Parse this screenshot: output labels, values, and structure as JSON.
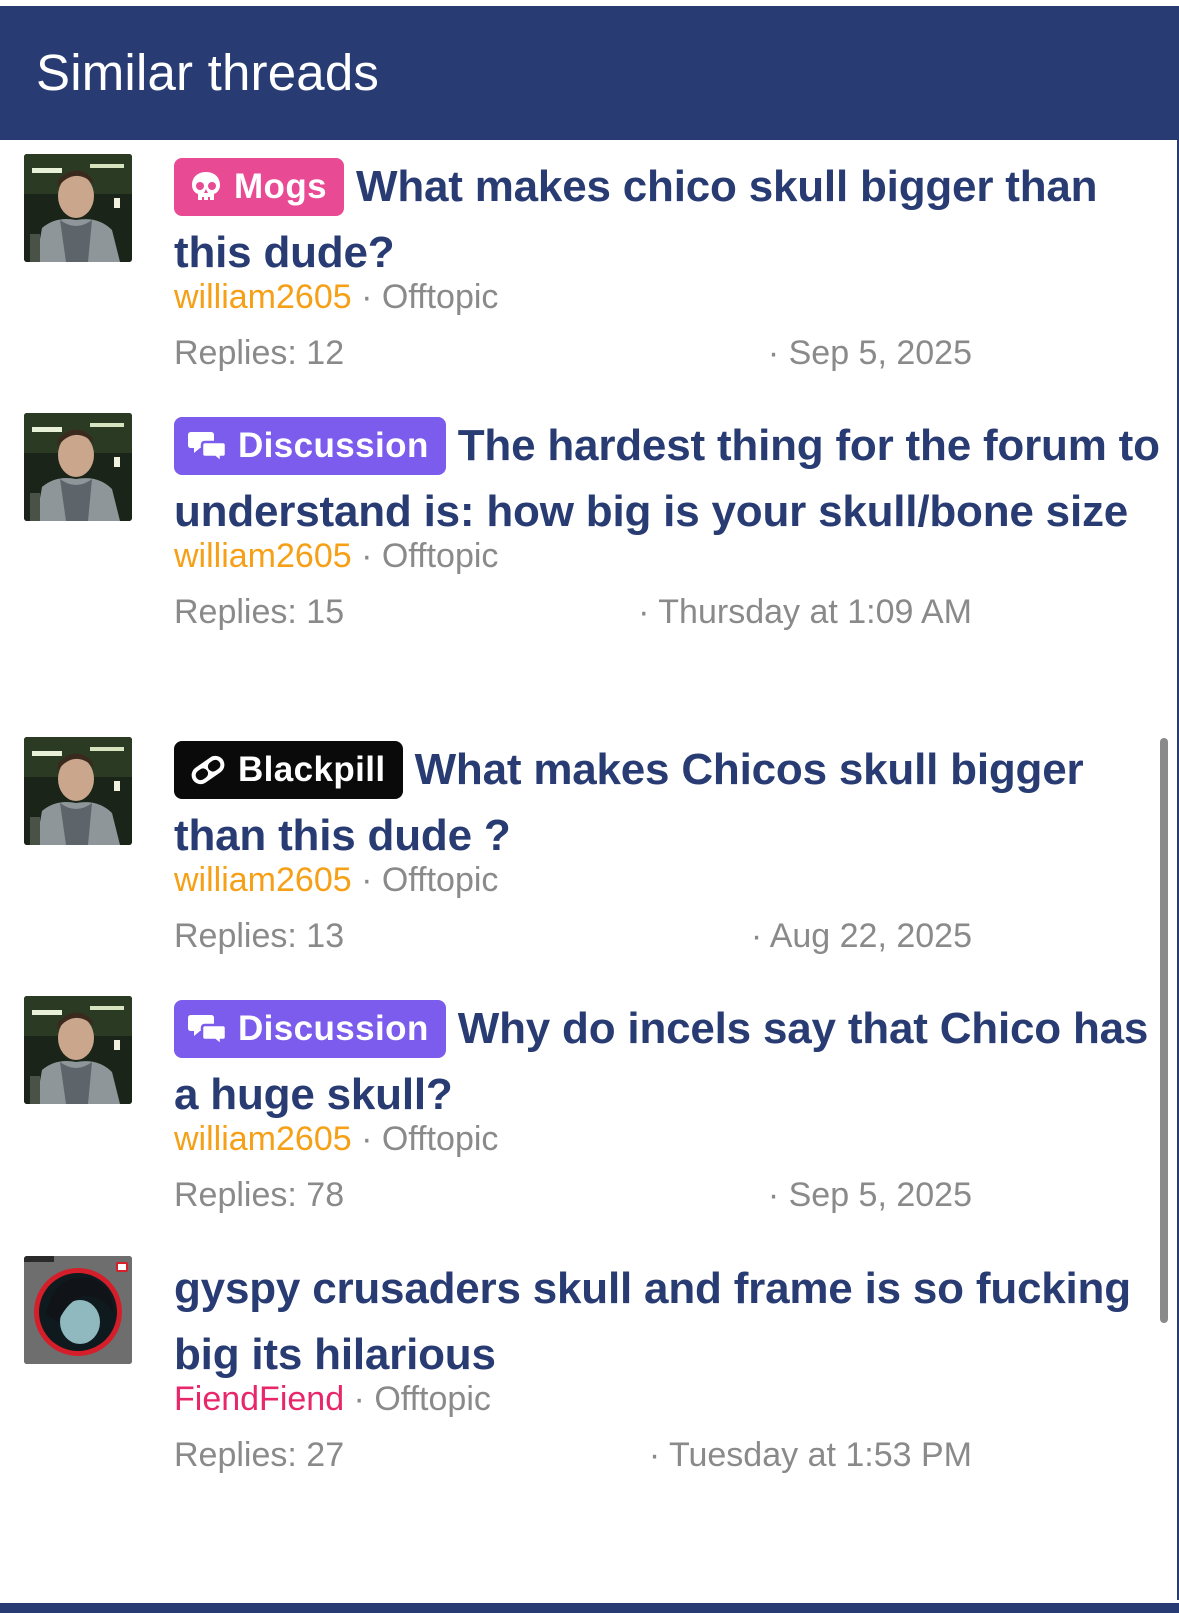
{
  "header": {
    "title": "Similar threads"
  },
  "colors": {
    "header_bg": "#283c73",
    "title_text": "#283c73",
    "meta_text": "#8a8a8a",
    "author_orange": "#f5a017",
    "author_pink": "#e8266a",
    "prefix_mogs": "#e84a94",
    "prefix_discussion": "#7b5ced",
    "prefix_blackpill": "#0a0a0a"
  },
  "threads": [
    {
      "prefix": "Mogs",
      "prefix_icon": "skull-icon",
      "title": "What makes chico skull bigger than this dude?",
      "author": "william2605",
      "forum": "Offtopic",
      "replies": "Replies: 12",
      "date": "· Sep 5, 2025"
    },
    {
      "prefix": "Discussion",
      "prefix_icon": "chat-bubbles-icon",
      "title": "The hardest thing for the forum to understand is: how big is your skull/bone size",
      "author": "william2605",
      "forum": "Offtopic",
      "replies": "Replies: 15",
      "date": "· Thursday at 1:09 AM"
    },
    {
      "prefix": "Blackpill",
      "prefix_icon": "pill-icon",
      "title": "What makes Chicos skull bigger than this dude ?",
      "author": "william2605",
      "forum": "Offtopic",
      "replies": "Replies: 13",
      "date": "· Aug 22, 2025"
    },
    {
      "prefix": "Discussion",
      "prefix_icon": "chat-bubbles-icon",
      "title": "Why do incels say that Chico has a huge skull?",
      "author": "william2605",
      "forum": "Offtopic",
      "replies": "Replies: 78",
      "date": "· Sep 5, 2025"
    },
    {
      "title": "gyspy crusaders skull and frame is so fucking big its hilarious",
      "author": "FiendFiend",
      "forum": "Offtopic",
      "replies": "Replies: 27",
      "date": "· Tuesday at 1:53 PM"
    }
  ]
}
